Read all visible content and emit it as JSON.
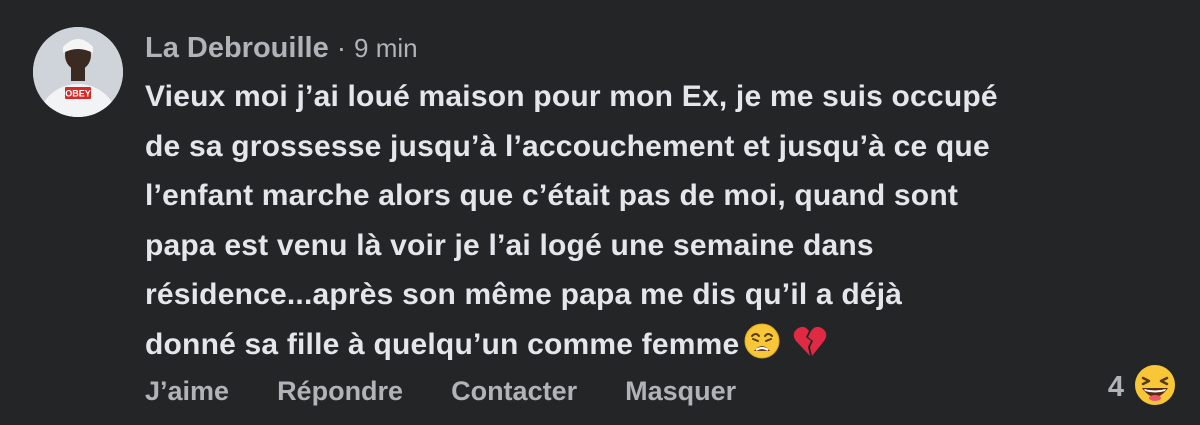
{
  "comment": {
    "author": "La Debrouille",
    "separator": "·",
    "time": "9 min",
    "avatar": {
      "icon": "avatar-photo",
      "shirt_text": "OBEY"
    },
    "lines": [
      "Vieux moi j’ai loué maison pour mon Ex, je me suis occupé",
      "de sa grossesse jusqu’à l’accouchement et jusqu’à ce que",
      "l’enfant marche alors que c’était pas de moi, quand sont",
      "papa est venu là voir je l’ai logé une semaine dans",
      "résidence...après son même papa me dis qu’il a déjà",
      "donné sa fille à quelqu’un comme femme"
    ],
    "trailing_emojis": [
      "weary-face-emoji",
      "broken-heart-emoji"
    ]
  },
  "actions": {
    "like": "J’aime",
    "reply": "Répondre",
    "contact": "Contacter",
    "hide": "Masquer"
  },
  "reaction": {
    "count": "4",
    "icon": "haha-reaction-icon"
  },
  "colors": {
    "background": "#242526",
    "primary_text": "#e4e6eb",
    "secondary_text": "#b0b3b8"
  }
}
